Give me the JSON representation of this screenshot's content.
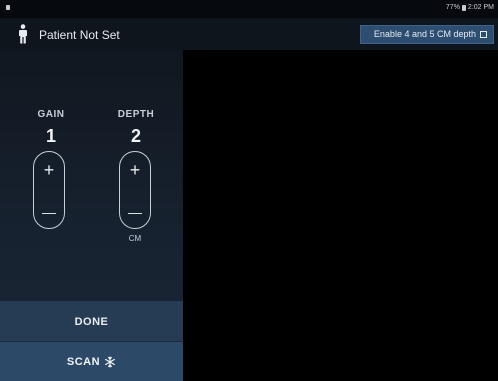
{
  "status_bar": {
    "battery": "77%",
    "time": "2:02 PM"
  },
  "header": {
    "patient_label": "Patient Not Set",
    "depth_toggle_label": "Enable 4 and 5 CM depth",
    "depth_toggle_checked": false
  },
  "controls": {
    "gain": {
      "label": "GAIN",
      "value": "1",
      "plus": "+",
      "minus": "—"
    },
    "depth": {
      "label": "DEPTH",
      "value": "2",
      "plus": "+",
      "minus": "—",
      "unit": "CM"
    }
  },
  "actions": {
    "done_label": "DONE",
    "scan_label": "SCAN"
  },
  "icons": {
    "patient": "person-icon",
    "scan": "snowflake-icon",
    "battery": "battery-icon"
  },
  "colors": {
    "header_bg": "#0f151c",
    "panel_bg": "#172230",
    "button_accent": "#2e4e71",
    "done_bg": "#263b54",
    "scan_bg": "#2d4968"
  }
}
